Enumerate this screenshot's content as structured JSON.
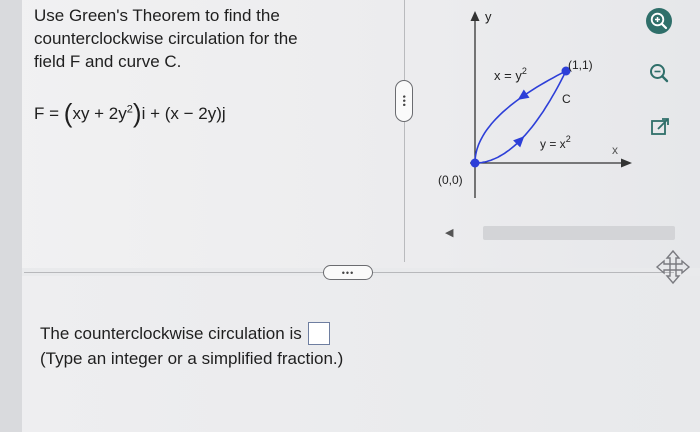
{
  "problem": {
    "line1": "Use Green's Theorem to find the",
    "line2": "counterclockwise circulation for the",
    "line3": "field F and curve C."
  },
  "formula": {
    "lhs": "F = ",
    "open": "(",
    "xy": "xy + 2y",
    "exp": "2",
    "close": ")",
    "rest": "i + (x − 2y)j"
  },
  "graph": {
    "y_axis": "y",
    "x_axis": "x",
    "upper_curve": "x = y",
    "upper_exp": "2",
    "lower_curve": "y = x",
    "lower_exp": "2",
    "curve_name": "C",
    "point_end": "(1,1)",
    "point_origin": "(0,0)",
    "curve_color": "#2d3fd8"
  },
  "handles": {
    "vertical": "•••",
    "horizontal": "•••"
  },
  "answer": {
    "prompt": "The counterclockwise circulation is",
    "hint": "(Type an integer or a simplified fraction.)"
  },
  "icons": [
    "zoom-in-icon",
    "zoom-out-icon",
    "external-link-icon",
    "move-icon"
  ]
}
